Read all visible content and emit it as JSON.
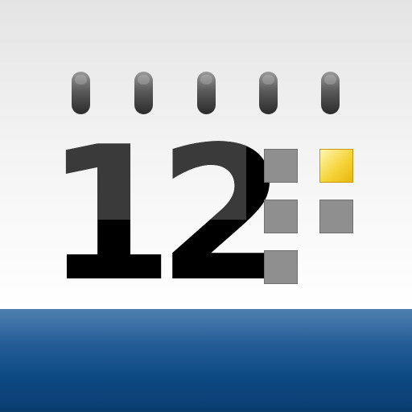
{
  "calendar_icon": {
    "day_number": "12",
    "ring_icons": [
      "binding-ring-icon",
      "binding-ring-icon",
      "binding-ring-icon",
      "binding-ring-icon",
      "binding-ring-icon"
    ],
    "day_squares": [
      "grey",
      "highlighted",
      "grey",
      "grey",
      "grey"
    ],
    "colors": {
      "number": "#000000",
      "square": "#8f8f8f",
      "highlight": "#f6d43a",
      "band": "#0d4a84"
    }
  }
}
